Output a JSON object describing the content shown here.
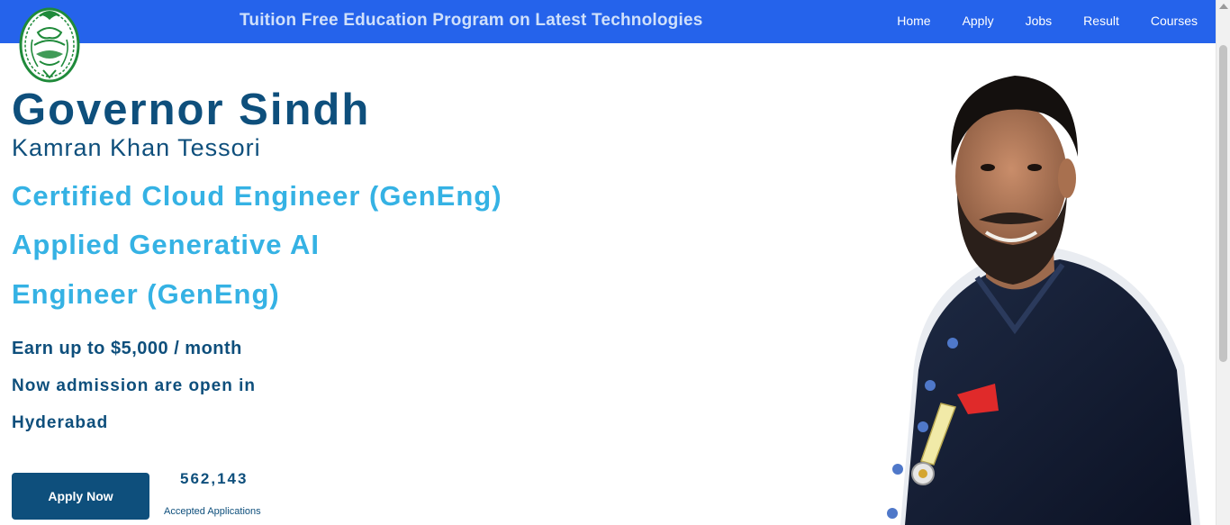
{
  "navbar": {
    "headline": "Tuition Free Education Program on Latest Technologies",
    "links": [
      "Home",
      "Apply",
      "Jobs",
      "Result",
      "Courses"
    ]
  },
  "hero": {
    "title": "Governor Sindh",
    "subtitle": "Kamran Khan Tessori",
    "course_lines": [
      "Certified Cloud Engineer (GenEng)",
      "Applied Generative AI",
      "Engineer (GenEng)"
    ],
    "earn_prefix": "Earn up to $5,000",
    "earn_suffix": "/ month",
    "admission_lines": [
      "Now admission are open in",
      "Hyderabad"
    ],
    "apply_button": "Apply Now",
    "accepted_count": "562,143",
    "accepted_label": "Accepted Applications"
  },
  "icons": {
    "logo": "governor-house-emblem-icon",
    "portrait": "governor-portrait-image"
  },
  "colors": {
    "navbar": "#2563eb",
    "headline_text": "#cfe0fb",
    "primary_navy": "#0e4f7c",
    "accent_cyan": "#35b2e4",
    "emblem_green": "#1f8a3a",
    "medal_red": "#e02a2a"
  }
}
